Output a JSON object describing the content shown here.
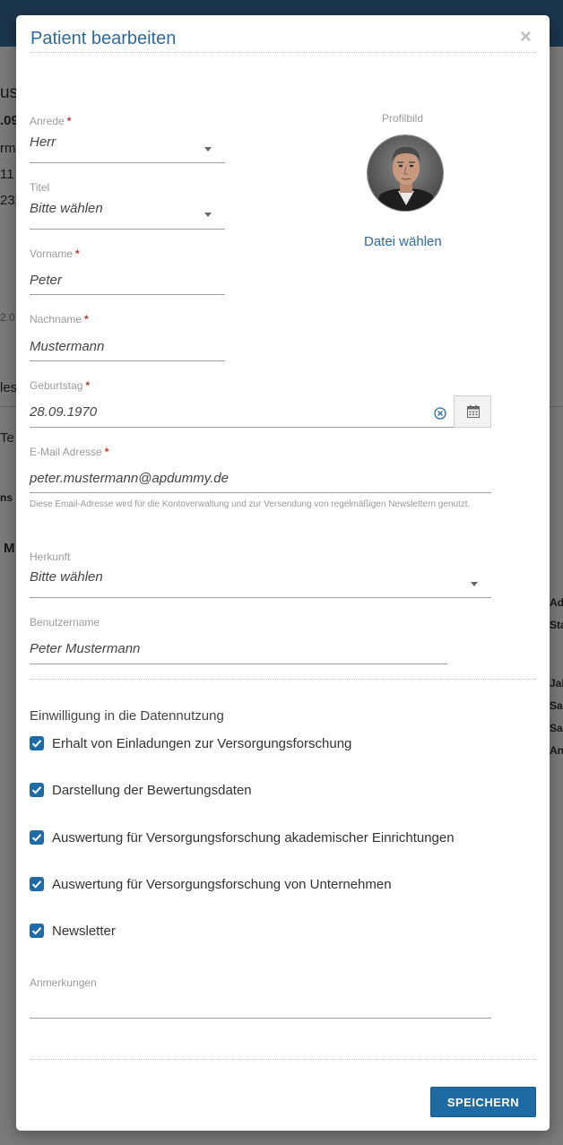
{
  "modal": {
    "title": "Patient bearbeiten",
    "close_symbol": "×"
  },
  "profile": {
    "label": "Profilbild",
    "file_link": "Datei wählen"
  },
  "fields": {
    "anrede": {
      "label": "Anrede",
      "value": "Herr",
      "required": "*"
    },
    "titel": {
      "label": "Titel",
      "value": "Bitte wählen"
    },
    "vorname": {
      "label": "Vorname",
      "value": "Peter",
      "required": "*"
    },
    "nachname": {
      "label": "Nachname",
      "value": "Mustermann",
      "required": "*"
    },
    "geburtstag": {
      "label": "Geburtstag",
      "value": "28.09.1970",
      "required": "*"
    },
    "email": {
      "label": "E-Mail Adresse",
      "value": "peter.mustermann@apdummy.de",
      "required": "*",
      "help": "Diese Email-Adresse wird für die Kontoverwaltung und zur Versendung von regelmäßigen Newslettern genutzt."
    },
    "herkunft": {
      "label": "Herkunft",
      "value": "Bitte wählen"
    },
    "benutzername": {
      "label": "Benutzername",
      "value": "Peter Mustermann"
    },
    "anmerkungen": {
      "label": "Anmerkungen",
      "value": ""
    }
  },
  "consent": {
    "title": "Einwilligung in die Datennutzung",
    "items": [
      {
        "label": "Erhalt von Einladungen zur Versorgungsforschung",
        "checked": true
      },
      {
        "label": "Darstellung der Bewertungsdaten",
        "checked": true
      },
      {
        "label": "Auswertung für Versorgungsforschung akademischer Einrichtungen",
        "checked": true
      },
      {
        "label": "Auswertung für Versorgungsforschung von Unternehmen",
        "checked": true
      },
      {
        "label": "Newsletter",
        "checked": true
      }
    ]
  },
  "actions": {
    "save_label": "SPEICHERN"
  },
  "colors": {
    "accent": "#2d6a9e",
    "button": "#1e6aa3",
    "required": "#c0392b"
  },
  "icons": {
    "close": "close-icon",
    "dropdown": "chevron-down-icon",
    "clear": "clear-circle-icon",
    "calendar": "calendar-icon",
    "checkbox": "checkmark-icon"
  }
}
